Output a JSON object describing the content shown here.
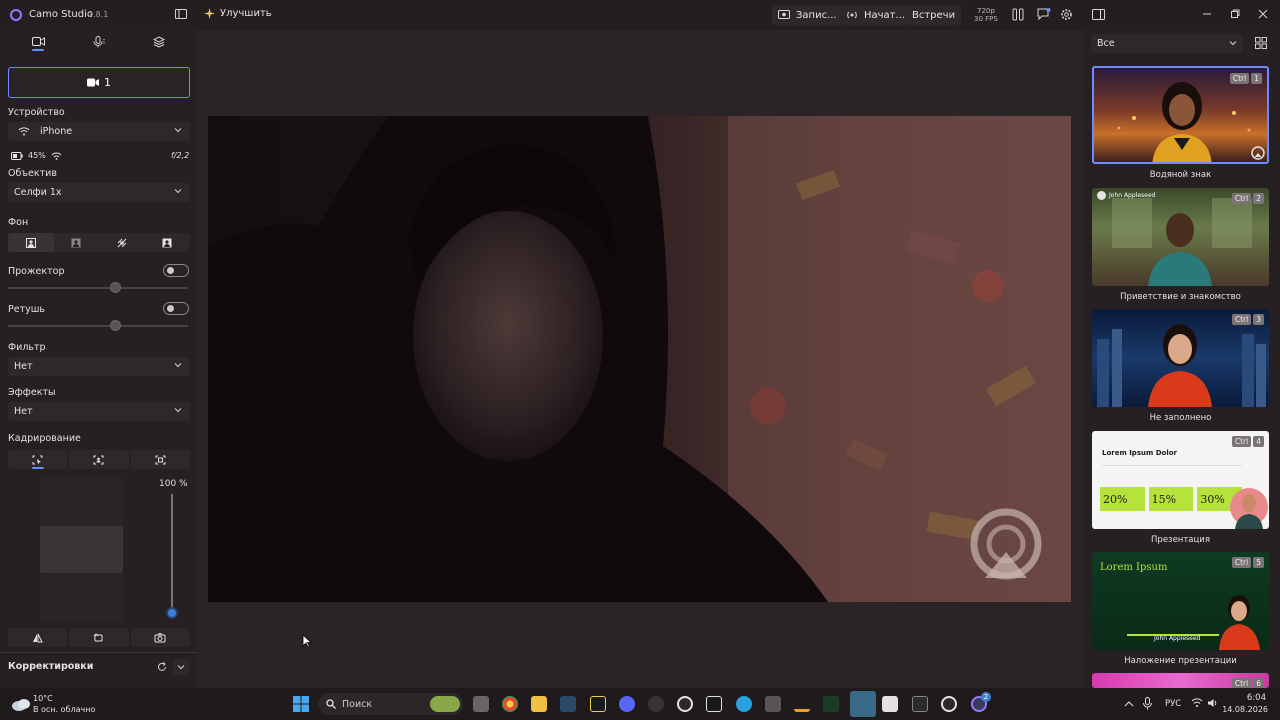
{
  "titlebar": {
    "app_name": "Camo Studio",
    "version": "2.8.1",
    "enhance_label": "Улучшить",
    "record_label": "Запис...",
    "stream_label": "Начат...",
    "meetings_label": "Встречи",
    "resolution": "720p",
    "fps": "30 FPS"
  },
  "left": {
    "source_button": "1",
    "device_label": "Устройство",
    "device_value": "iPhone",
    "battery": "45%",
    "aperture": "f/2,2",
    "lens_label": "Объектив",
    "lens_value": "Селфи 1x",
    "background_label": "Фон",
    "spotlight_label": "Прожектор",
    "retouch_label": "Ретушь",
    "filter_label": "Фильтр",
    "filter_value": "Нет",
    "effects_label": "Эффекты",
    "effects_value": "Нет",
    "framing_label": "Кадрирование",
    "zoom_value": "100 %",
    "adjustments_label": "Корректировки"
  },
  "right": {
    "filter_value": "Все",
    "cards": [
      {
        "label": "Водяной знак",
        "ctrl": "Ctrl",
        "num": "1"
      },
      {
        "label": "Приветствие и знакомство",
        "ctrl": "Ctrl",
        "num": "2",
        "overlay_name": "John Appleseed"
      },
      {
        "label": "Не заполнено",
        "ctrl": "Ctrl",
        "num": "3"
      },
      {
        "label": "Презентация",
        "ctrl": "Ctrl",
        "num": "4",
        "slide_title": "Lorem Ipsum Dolor",
        "stats": [
          "20%",
          "15%",
          "30%"
        ]
      },
      {
        "label": "Наложение презентации",
        "ctrl": "Ctrl",
        "num": "5",
        "slide_title": "Lorem Ipsum",
        "overlay_name": "John Appleseed"
      },
      {
        "label": "",
        "ctrl": "Ctrl",
        "num": "6"
      }
    ]
  },
  "taskbar": {
    "temperature": "10°C",
    "weather": "В осн. облачно",
    "search_placeholder": "Поиск",
    "language": "РУС",
    "time": "6:04",
    "date": "14.08.2026",
    "notification_count": "2"
  },
  "colors": {
    "accent": "#6b8cff",
    "knob_blue": "#3f7fd6",
    "present_green": "#b6e23c"
  }
}
